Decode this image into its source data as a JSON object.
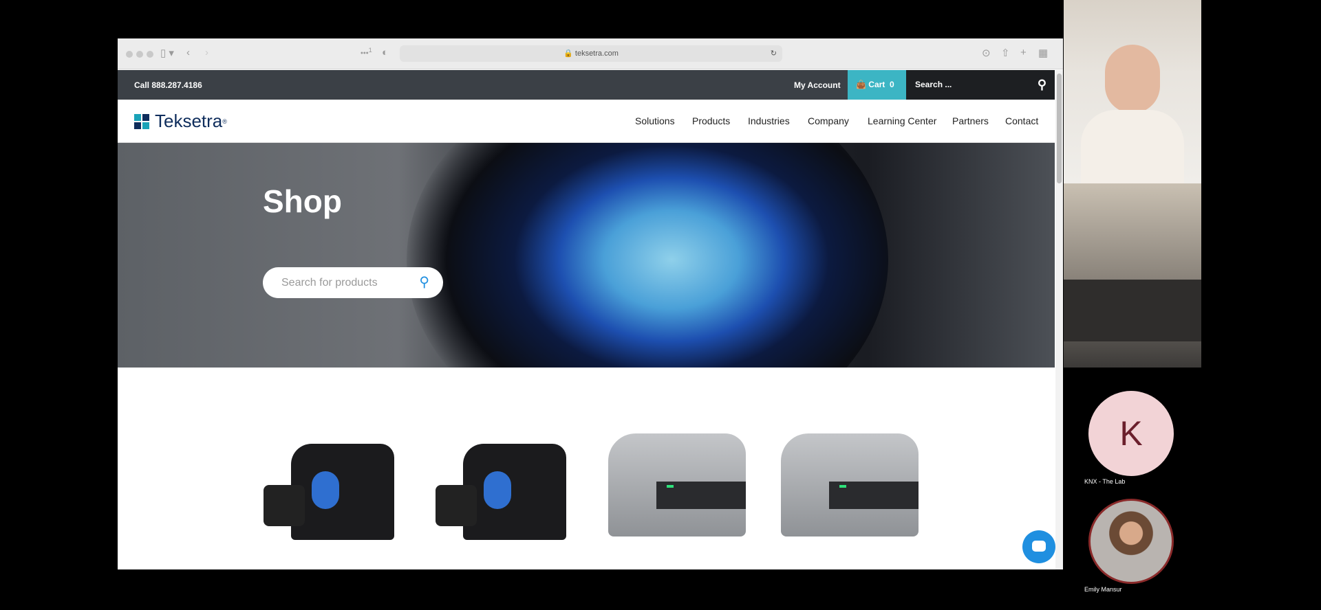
{
  "browser": {
    "url": "teksetra.com",
    "badge": "1"
  },
  "topbar": {
    "phone": "Call 888.287.4186",
    "account": "My Account",
    "cart_label": "Cart",
    "cart_count": "0",
    "search_placeholder": "Search ..."
  },
  "site": {
    "logo": "Teksetra",
    "nav": [
      "Solutions",
      "Products",
      "Industries",
      "Company",
      "Learning Center",
      "Partners",
      "Contact"
    ]
  },
  "hero": {
    "title": "Shop",
    "search_placeholder": "Search for products"
  },
  "colors": {
    "accent": "#3cb5c4",
    "topbar": "#3b4046",
    "chat": "#1f8fe0"
  },
  "meeting": {
    "participants": [
      {
        "initial": "K",
        "name": "KNX - The Lab"
      },
      {
        "name": "Emily Mansur"
      }
    ]
  }
}
